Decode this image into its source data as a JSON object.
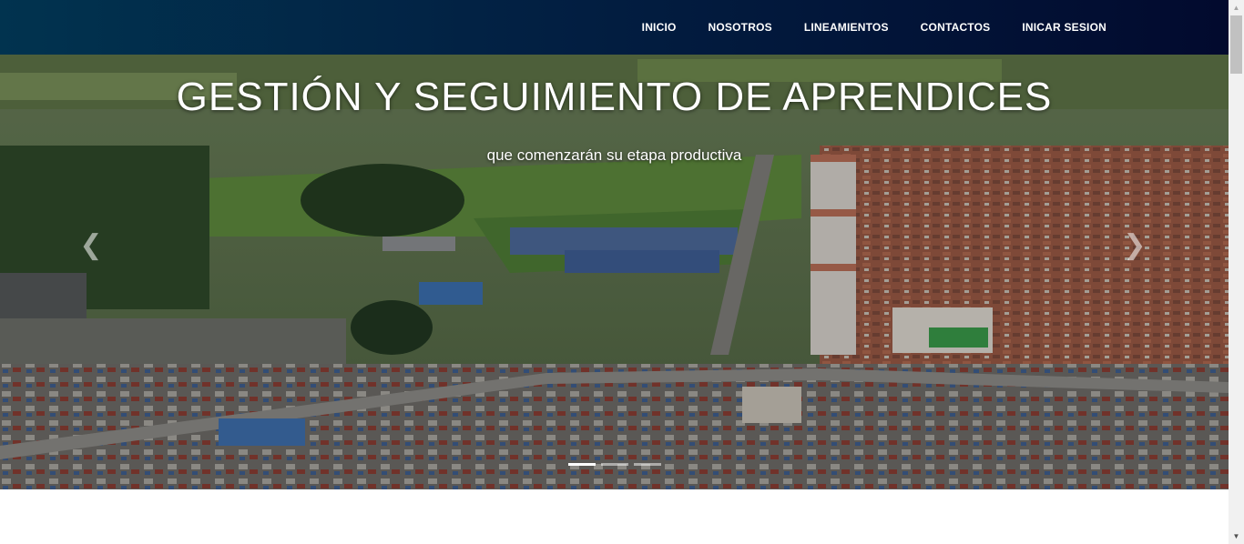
{
  "nav": {
    "items": [
      {
        "label": "INICIO"
      },
      {
        "label": "NOSOTROS"
      },
      {
        "label": "LINEAMIENTOS"
      },
      {
        "label": "CONTACTOS"
      },
      {
        "label": "INICAR SESION"
      }
    ]
  },
  "hero": {
    "title": "GESTIÓN Y SEGUIMIENTO DE APRENDICES",
    "subtitle": "que comenzarán su etapa productiva",
    "prev_icon": "chevron-left-icon",
    "next_icon": "chevron-right-icon",
    "slides_total": 3,
    "active_slide": 1
  },
  "colors": {
    "nav_start": "#01334f",
    "nav_end": "#020a2e",
    "text": "#ffffff"
  }
}
